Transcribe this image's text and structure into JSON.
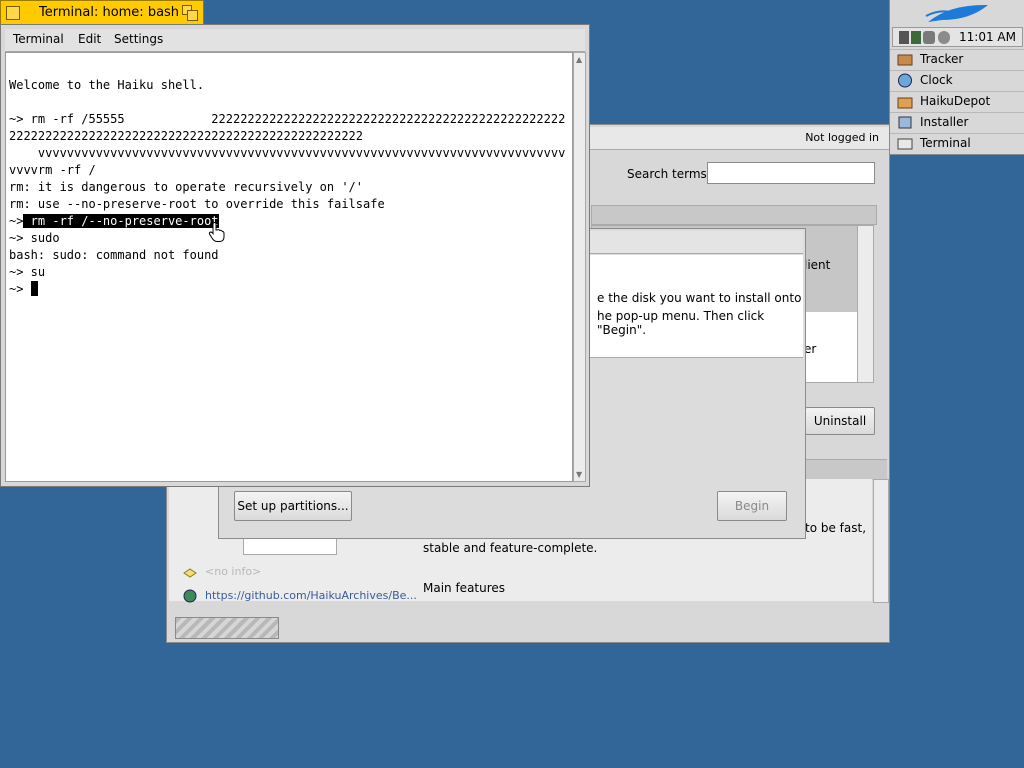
{
  "deskbar": {
    "clock": "11:01 AM",
    "apps": [
      {
        "label": "Tracker",
        "icon": "tracker-icon"
      },
      {
        "label": "Clock",
        "icon": "clock-icon"
      },
      {
        "label": "HaikuDepot",
        "icon": "haikudepot-icon"
      },
      {
        "label": "Installer",
        "icon": "installer-icon"
      },
      {
        "label": "Terminal",
        "icon": "terminal-icon"
      }
    ]
  },
  "depot": {
    "login_status": "Not logged in",
    "search_label": "Search terms:",
    "search_value": "",
    "list_text_1": "lient",
    "list_text_2": "er",
    "uninstall_label": "Uninstall",
    "no_info": "<no info>",
    "link": "https://github.com/HaikuArchives/Be...",
    "desc_1": "to be fast,",
    "desc_2": "stable and feature-complete.",
    "desc_3": "Main features"
  },
  "installer": {
    "msg_1": "e the disk you want to install onto",
    "msg_2": "he pop-up menu. Then click \"Begin\".",
    "setup_label": "Set up partitions...",
    "begin_label": "Begin"
  },
  "terminal": {
    "title": "Terminal: home: bash",
    "menus": [
      "Terminal",
      "Edit",
      "Settings"
    ],
    "lines": [
      "",
      "Welcome to the Haiku shell.",
      "",
      "~> rm -rf /55555            2222222222222222222222222222222222222222222222222",
      "2222222222222222222222222222222222222222222222222",
      "    vvvvvvvvvvvvvvvvvvvvvvvvvvvvvvvvvvvvvvvvvvvvvvvvvvvvvvvvvvvvvvvvvvvvvvvvv",
      "vvvvrm -rf /",
      "rm: it is dangerous to operate recursively on '/'",
      "rm: use --no-preserve-root to override this failsafe",
      "",
      "~> sudo",
      "bash: sudo: command not found",
      "~> su",
      "~> "
    ],
    "selected_prefix": "~>",
    "selected_text": " rm -rf /--no-preserve-root"
  }
}
